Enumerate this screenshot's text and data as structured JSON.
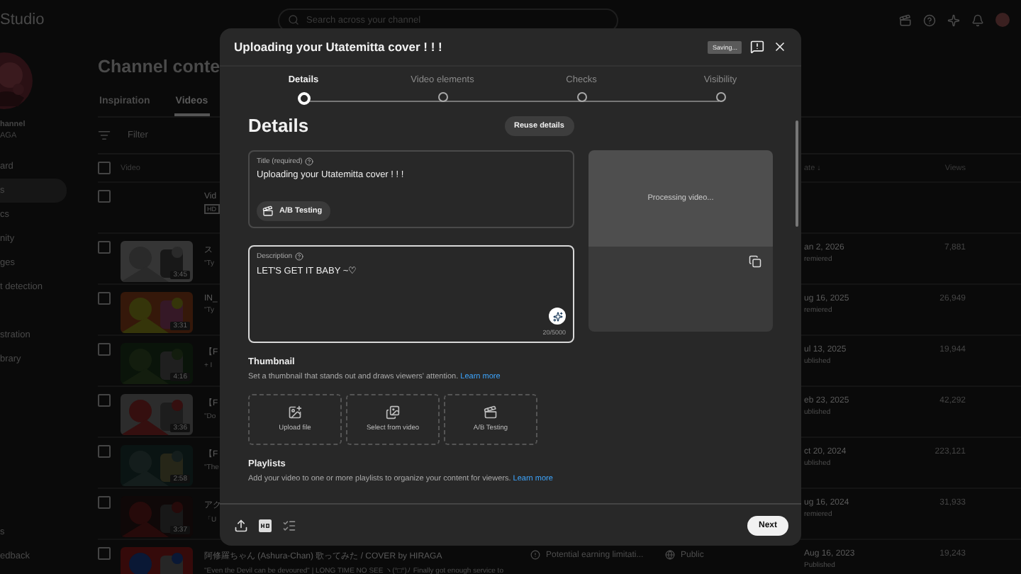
{
  "header": {
    "logo": "Studio",
    "search_placeholder": "Search across your channel"
  },
  "sidebar": {
    "channel_name": "hannel",
    "channel_handle": "AGA",
    "sections": [
      {
        "items": [
          {
            "label": "ard",
            "selected": false
          },
          {
            "label": "s",
            "selected": true
          },
          {
            "label": "cs",
            "selected": false
          },
          {
            "label": "nity",
            "selected": false
          },
          {
            "label": "ges",
            "selected": false
          },
          {
            "label": "t detection",
            "selected": false
          }
        ]
      },
      {
        "items": [
          {
            "label": "stration",
            "selected": false
          },
          {
            "label": "brary",
            "selected": false
          }
        ]
      }
    ],
    "bottom_items": [
      {
        "label": "s",
        "selected": false
      },
      {
        "label": "edback",
        "selected": false
      }
    ]
  },
  "page": {
    "title": "Channel conte",
    "tabs": [
      {
        "label": "Inspiration",
        "selected": false
      },
      {
        "label": "Videos",
        "selected": true
      }
    ],
    "filter_placeholder": "Filter",
    "header_checked": false,
    "columns": {
      "video": "Video",
      "date": "ate ↓",
      "views": "Views"
    },
    "rows": [
      {
        "kind": "uploading",
        "checked": false,
        "title": "Vid",
        "badge": "HD"
      },
      {
        "kind": "video",
        "checked": false,
        "duration": "3:45",
        "title": "ス",
        "subtitle": "\"Ty",
        "date": "an 2, 2026",
        "status": "remiered",
        "views": "7,881"
      },
      {
        "kind": "video",
        "checked": false,
        "duration": "3:31",
        "title": "IN_",
        "subtitle": "\"Ty",
        "date": "ug 16, 2025",
        "status": "remiered",
        "views": "26,949"
      },
      {
        "kind": "video",
        "checked": false,
        "duration": "4:16",
        "title": "【F",
        "subtitle": "+ I",
        "date": "ul 13, 2025",
        "status": "ublished",
        "views": "19,944"
      },
      {
        "kind": "video",
        "checked": false,
        "duration": "3:36",
        "title": "【F",
        "subtitle": "\"Do",
        "date": "eb 23, 2025",
        "status": "ublished",
        "views": "42,292"
      },
      {
        "kind": "video",
        "checked": false,
        "duration": "2:58",
        "title": "【F",
        "subtitle": "\"The",
        "date": "ct 20, 2024",
        "status": "ublished",
        "views": "223,121"
      },
      {
        "kind": "video",
        "checked": false,
        "duration": "3:37",
        "title": "アク",
        "subtitle": "「U",
        "date": "ug 16, 2024",
        "status": "remiered",
        "views": "31,933"
      },
      {
        "kind": "video",
        "checked": false,
        "title": "阿修羅ちゃん (Ashura-Chan) 歌ってみた / COVER by HIRAGA",
        "subtitle": "\"Even the Devil can be devoured\" | LONG TIME NO SEE ヽ(°□°)ﾉ Finally got enough service to",
        "restriction": "Potential earning limitati...",
        "visibility": "Public",
        "date": "Aug 16, 2023",
        "status": "Published",
        "views": "19,243"
      }
    ]
  },
  "dialog": {
    "title": "Uploading your Utatemitta cover ! ! !",
    "status_badge": "Saving...",
    "steps": [
      {
        "label": "Details",
        "selected": true
      },
      {
        "label": "Video elements",
        "selected": false
      },
      {
        "label": "Checks",
        "selected": false
      },
      {
        "label": "Visibility",
        "selected": false
      }
    ],
    "heading": "Details",
    "reuse_button": "Reuse details",
    "title_field": {
      "label": "Title (required)",
      "value": "Uploading your Utatemitta cover ! ! !",
      "ab_button": "A/B Testing"
    },
    "description_field": {
      "label": "Description",
      "value": "LET'S GET IT BABY ~♡",
      "counter": "20/5000",
      "focused": true
    },
    "preview": {
      "status": "Processing video..."
    },
    "thumbnail": {
      "heading": "Thumbnail",
      "text": "Set a thumbnail that stands out and draws viewers' attention.",
      "link": "Learn more",
      "options": [
        {
          "kind": "upload",
          "label": "Upload file"
        },
        {
          "kind": "select",
          "label": "Select from video"
        },
        {
          "kind": "ab",
          "label": "A/B Testing"
        }
      ]
    },
    "playlists": {
      "heading": "Playlists",
      "text": "Add your video to one or more playlists to organize your content for viewers.",
      "link": "Learn more"
    },
    "next_button": "Next"
  }
}
